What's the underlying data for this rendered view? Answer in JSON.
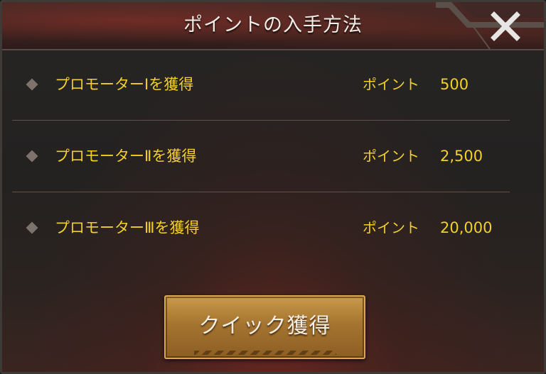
{
  "dialog": {
    "title": "ポイントの入手方法",
    "close_icon": "close-x-icon"
  },
  "rows": [
    {
      "label": "プロモーターⅠを獲得",
      "points_label": "ポイント",
      "points_value": "500",
      "bullet_icon": "diamond-bullet-icon"
    },
    {
      "label": "プロモーターⅡを獲得",
      "points_label": "ポイント",
      "points_value": "2,500",
      "bullet_icon": "diamond-bullet-icon"
    },
    {
      "label": "プロモーターⅢを獲得",
      "points_label": "ポイント",
      "points_value": "20,000",
      "bullet_icon": "diamond-bullet-icon"
    }
  ],
  "quick_button": {
    "label": "クイック獲得"
  },
  "colors": {
    "accent_yellow": "#f3cf2a",
    "header_red": "#4a2a26",
    "button_gold": "#b4843a"
  }
}
